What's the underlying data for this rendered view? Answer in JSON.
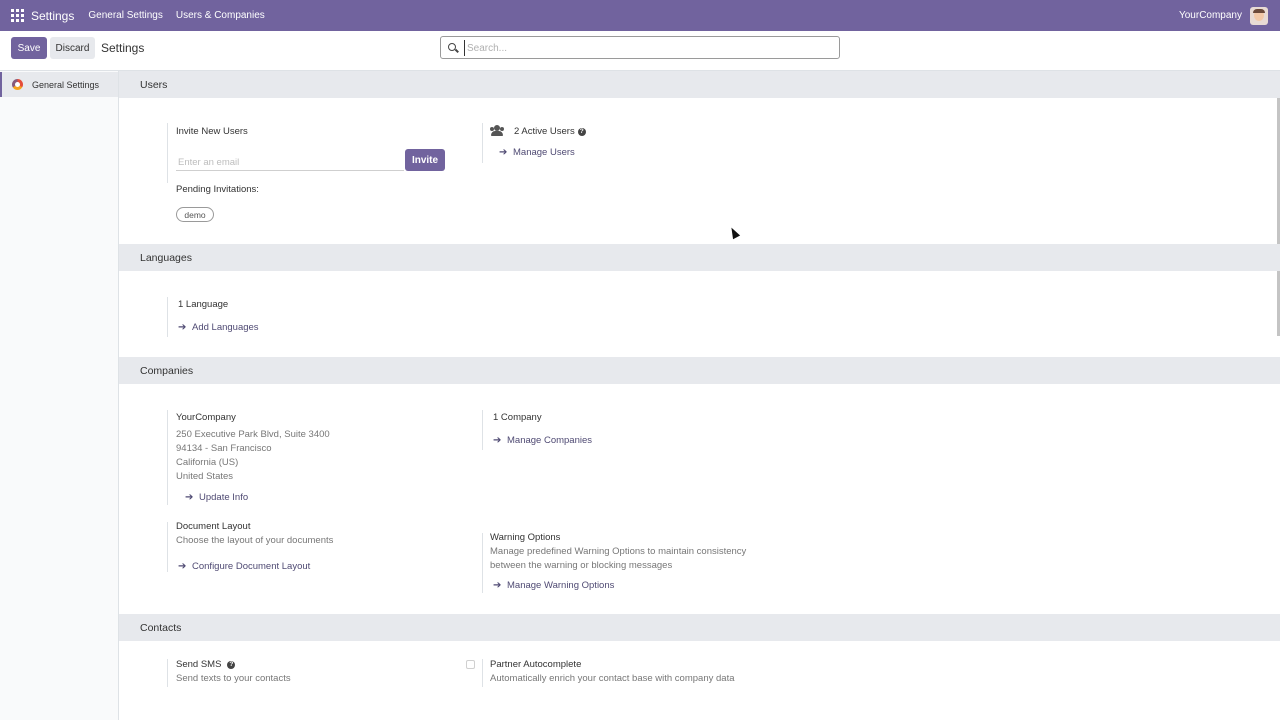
{
  "navbar": {
    "app_name": "Settings",
    "links": [
      "General Settings",
      "Users & Companies"
    ],
    "company": "YourCompany"
  },
  "control": {
    "save_label": "Save",
    "discard_label": "Discard",
    "breadcrumb": "Settings",
    "search_placeholder": "Search...",
    "search_value": ""
  },
  "sidebar": {
    "items": [
      {
        "label": "General Settings",
        "icon": "settings-app-logo",
        "active": true
      }
    ]
  },
  "users": {
    "title": "Users",
    "invite_label": "Invite New Users",
    "email_placeholder": "Enter an email",
    "invite_button": "Invite",
    "pending_label": "Pending Invitations:",
    "pending": [
      "demo"
    ],
    "active_users": "2 Active Users",
    "manage_users": "Manage Users"
  },
  "languages": {
    "title": "Languages",
    "count": "1 Language",
    "add_link": "Add Languages"
  },
  "companies": {
    "title": "Companies",
    "company_name": "YourCompany",
    "address": [
      "250 Executive Park Blvd, Suite 3400",
      "94134 - San Francisco",
      "California (US)",
      "United States"
    ],
    "update_link": "Update Info",
    "count": "1 Company",
    "manage_link": "Manage Companies",
    "doc_layout_title": "Document Layout",
    "doc_layout_desc": "Choose the layout of your documents",
    "doc_layout_link": "Configure Document Layout",
    "warning_title": "Warning Options",
    "warning_desc": [
      "Manage predefined Warning Options to maintain consistency",
      "between the warning or blocking messages"
    ],
    "warning_link": "Manage Warning Options"
  },
  "contacts": {
    "title": "Contacts",
    "sms_title": "Send SMS",
    "sms_desc": "Send texts to your contacts",
    "autocomplete_title": "Partner Autocomplete",
    "autocomplete_desc": "Automatically enrich your contact base with company data",
    "autocomplete_checked": false
  },
  "colors": {
    "brand": "#71639e",
    "section_bg": "#e7e9ed",
    "link": "#4f4a73"
  }
}
